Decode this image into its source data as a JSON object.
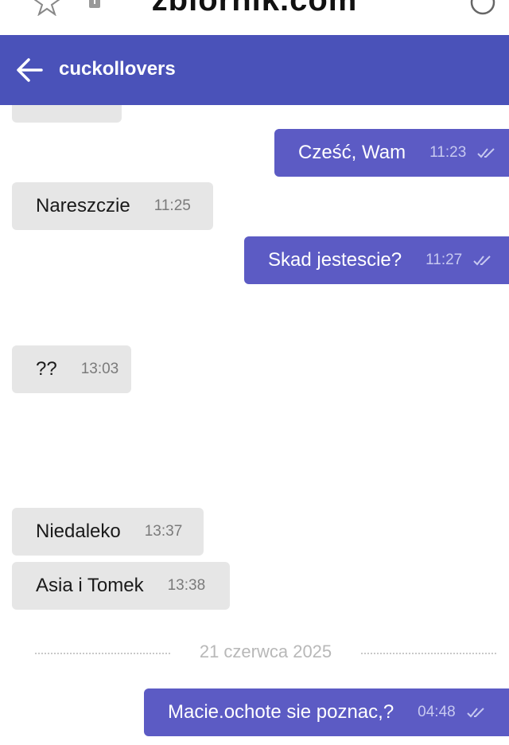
{
  "browser": {
    "url": "zbiornik.com"
  },
  "header": {
    "title": "cuckollovers"
  },
  "messages": [
    {
      "text": "Cześć, Wam",
      "time": "11:23",
      "direction": "out"
    },
    {
      "text": "Nareszczie",
      "time": "11:25",
      "direction": "in"
    },
    {
      "text": "Skad jestescie?",
      "time": "11:27",
      "direction": "out"
    },
    {
      "text": "??",
      "time": "13:03",
      "direction": "in"
    },
    {
      "text": "Niedaleko",
      "time": "13:37",
      "direction": "in"
    },
    {
      "text": "Asia i Tomek",
      "time": "13:38",
      "direction": "in"
    },
    {
      "text": "Macie.ochote sie poznac,?",
      "time": "04:48",
      "direction": "out"
    }
  ],
  "date_separator": "21 czerwca 2025",
  "colors": {
    "header_bg": "#4a52b9",
    "outgoing_bg": "#5c5bc4",
    "incoming_bg": "#e6e6e6"
  }
}
